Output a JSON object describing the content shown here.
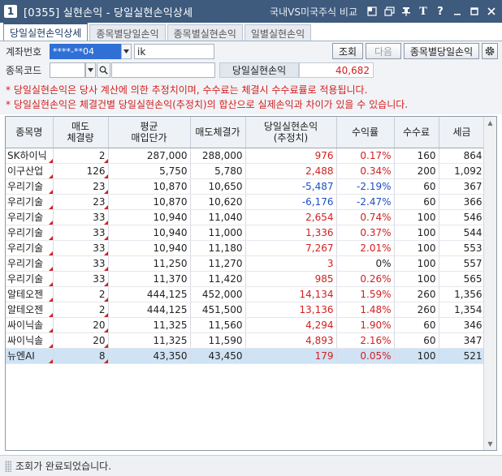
{
  "window": {
    "badge": "1",
    "title": "[0355] 실현손익 - 당일실현손익상세",
    "compare_link": "국내VS미국주식 비교"
  },
  "tabs": [
    {
      "label": "당일실현손익상세",
      "active": true
    },
    {
      "label": "종목별당일손익",
      "active": false
    },
    {
      "label": "종목별실현손익",
      "active": false
    },
    {
      "label": "일별실현손익",
      "active": false
    }
  ],
  "form": {
    "account_label": "계좌번호",
    "account_value": "****-**04",
    "account_name": "ik",
    "stock_code_label": "종목코드",
    "stock_code_value": "",
    "stock_name_value": "",
    "query_button": "조회",
    "next_button": "다음",
    "by_stock_button": "종목별당일손익",
    "pl_label": "당일실현손익",
    "pl_value": "40,682"
  },
  "notices": [
    "* 당일실현손익은 당사 계산에 의한 추정치이며, 수수료는 체결시 수수료률로 적용됩니다.",
    "* 당일실현손익은 체결건별 당일실현손익(추정치)의 합산으로 실제손익과 차이가 있을 수 있습니다."
  ],
  "table": {
    "headers": [
      "종목명",
      "매도\n체결량",
      "평균\n매입단가",
      "매도체결가",
      "당일실현손익\n(추정치)",
      "수익률",
      "수수료",
      "세금"
    ],
    "rows": [
      {
        "name": "SK하이닉",
        "qty": "2",
        "avg": "287,000",
        "sell": "288,000",
        "pl": "976",
        "rate": "0.17%",
        "fee": "160",
        "tax": "864",
        "sign": "pos",
        "selected": false
      },
      {
        "name": "이구산업",
        "qty": "126",
        "avg": "5,750",
        "sell": "5,780",
        "pl": "2,488",
        "rate": "0.34%",
        "fee": "200",
        "tax": "1,092",
        "sign": "pos",
        "selected": false
      },
      {
        "name": "우리기술",
        "qty": "23",
        "avg": "10,870",
        "sell": "10,650",
        "pl": "-5,487",
        "rate": "-2.19%",
        "fee": "60",
        "tax": "367",
        "sign": "neg",
        "selected": false
      },
      {
        "name": "우리기술",
        "qty": "23",
        "avg": "10,870",
        "sell": "10,620",
        "pl": "-6,176",
        "rate": "-2.47%",
        "fee": "60",
        "tax": "366",
        "sign": "neg",
        "selected": false
      },
      {
        "name": "우리기술",
        "qty": "33",
        "avg": "10,940",
        "sell": "11,040",
        "pl": "2,654",
        "rate": "0.74%",
        "fee": "100",
        "tax": "546",
        "sign": "pos",
        "selected": false
      },
      {
        "name": "우리기술",
        "qty": "33",
        "avg": "10,940",
        "sell": "11,000",
        "pl": "1,336",
        "rate": "0.37%",
        "fee": "100",
        "tax": "544",
        "sign": "pos",
        "selected": false
      },
      {
        "name": "우리기술",
        "qty": "33",
        "avg": "10,940",
        "sell": "11,180",
        "pl": "7,267",
        "rate": "2.01%",
        "fee": "100",
        "tax": "553",
        "sign": "pos",
        "selected": false
      },
      {
        "name": "우리기술",
        "qty": "33",
        "avg": "11,250",
        "sell": "11,270",
        "pl": "3",
        "rate": "0%",
        "fee": "100",
        "tax": "557",
        "sign": "zero",
        "selected": false
      },
      {
        "name": "우리기술",
        "qty": "33",
        "avg": "11,370",
        "sell": "11,420",
        "pl": "985",
        "rate": "0.26%",
        "fee": "100",
        "tax": "565",
        "sign": "pos",
        "selected": false
      },
      {
        "name": "알테오젠",
        "qty": "2",
        "avg": "444,125",
        "sell": "452,000",
        "pl": "14,134",
        "rate": "1.59%",
        "fee": "260",
        "tax": "1,356",
        "sign": "pos",
        "selected": false
      },
      {
        "name": "알테오젠",
        "qty": "2",
        "avg": "444,125",
        "sell": "451,500",
        "pl": "13,136",
        "rate": "1.48%",
        "fee": "260",
        "tax": "1,354",
        "sign": "pos",
        "selected": false
      },
      {
        "name": "싸이닉솔",
        "qty": "20",
        "avg": "11,325",
        "sell": "11,560",
        "pl": "4,294",
        "rate": "1.90%",
        "fee": "60",
        "tax": "346",
        "sign": "pos",
        "selected": false
      },
      {
        "name": "싸이닉솔",
        "qty": "20",
        "avg": "11,325",
        "sell": "11,590",
        "pl": "4,893",
        "rate": "2.16%",
        "fee": "60",
        "tax": "347",
        "sign": "pos",
        "selected": false
      },
      {
        "name": "뉴엔AI",
        "qty": "8",
        "avg": "43,350",
        "sell": "43,450",
        "pl": "179",
        "rate": "0.05%",
        "fee": "100",
        "tax": "521",
        "sign": "pos",
        "selected": true
      }
    ]
  },
  "status": {
    "message": "조회가 완료되었습니다."
  },
  "icons": {
    "title_icons": [
      "restore-window-icon",
      "copy-window-icon",
      "pin-icon",
      "font-size-icon",
      "help-icon",
      "minimize-icon",
      "maximize-icon",
      "close-icon"
    ],
    "settings": "gear-icon"
  },
  "colors": {
    "titlebar": "#3e5a7c",
    "positive": "#d21f1f",
    "negative": "#1e4fc2",
    "selected_row": "#cfe3f5",
    "account_highlight": "#2f6fd6"
  }
}
